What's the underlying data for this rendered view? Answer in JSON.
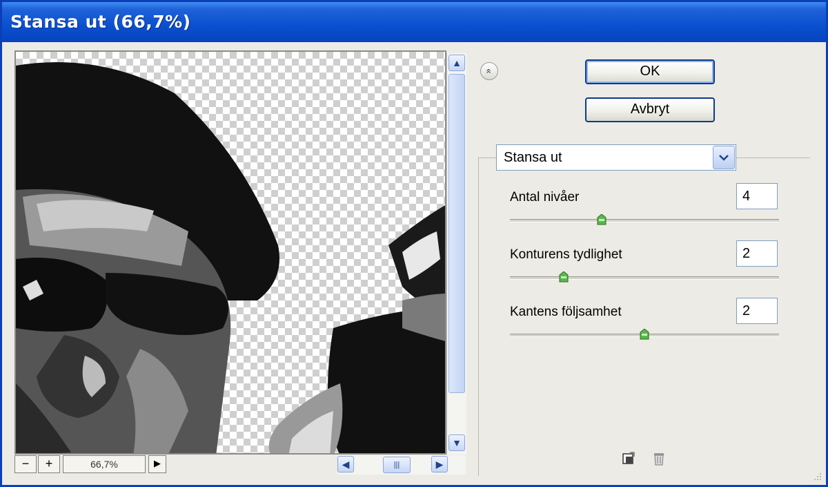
{
  "window": {
    "title": "Stansa ut (66,7%)"
  },
  "preview": {
    "zoom_out_label": "−",
    "zoom_in_label": "+",
    "zoom_value": "66,7%",
    "menu_arrow": "▶"
  },
  "scroll": {
    "up": "▲",
    "down": "▼",
    "left": "◀",
    "right": "▶",
    "grip": "|||"
  },
  "buttons": {
    "ok": "OK",
    "cancel": "Avbryt",
    "expand": "«"
  },
  "filter": {
    "selected": "Stansa ut",
    "dropdown_icon": "chevron-down"
  },
  "params": [
    {
      "label": "Antal nivåer",
      "value": "4",
      "slider": 0.34
    },
    {
      "label": "Konturens tydlighet",
      "value": "2",
      "slider": 0.2
    },
    {
      "label": "Kantens följsamhet",
      "value": "2",
      "slider": 0.5
    }
  ],
  "icons": {
    "new_layer": "new-effect-layer-icon",
    "delete": "trash-icon"
  }
}
